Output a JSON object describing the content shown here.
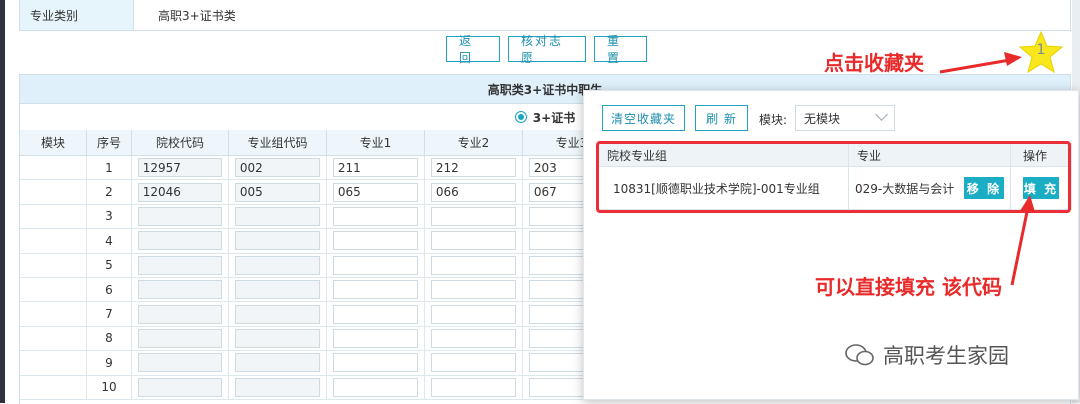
{
  "category": {
    "label": "专业类别",
    "value": "高职3+证书类"
  },
  "actions": {
    "back": "返 回",
    "verify": "核对志愿",
    "reset": "重 置"
  },
  "table": {
    "title": "高职类3+证书中职生",
    "radio_label": "3+证书",
    "headers": [
      "模块",
      "序号",
      "院校代码",
      "专业组代码",
      "专业1",
      "专业2",
      "专业3"
    ],
    "rows": [
      {
        "no": "1",
        "school": "12957",
        "group": "002",
        "m1": "211",
        "m2": "212",
        "m3": "203"
      },
      {
        "no": "2",
        "school": "12046",
        "group": "005",
        "m1": "065",
        "m2": "066",
        "m3": "067"
      },
      {
        "no": "3",
        "school": "",
        "group": "",
        "m1": "",
        "m2": "",
        "m3": ""
      },
      {
        "no": "4",
        "school": "",
        "group": "",
        "m1": "",
        "m2": "",
        "m3": ""
      },
      {
        "no": "5",
        "school": "",
        "group": "",
        "m1": "",
        "m2": "",
        "m3": ""
      },
      {
        "no": "6",
        "school": "",
        "group": "",
        "m1": "",
        "m2": "",
        "m3": ""
      },
      {
        "no": "7",
        "school": "",
        "group": "",
        "m1": "",
        "m2": "",
        "m3": ""
      },
      {
        "no": "8",
        "school": "",
        "group": "",
        "m1": "",
        "m2": "",
        "m3": ""
      },
      {
        "no": "9",
        "school": "",
        "group": "",
        "m1": "",
        "m2": "",
        "m3": ""
      },
      {
        "no": "10",
        "school": "",
        "group": "",
        "m1": "",
        "m2": "",
        "m3": ""
      }
    ]
  },
  "favorites": {
    "clear_button": "清空收藏夹",
    "refresh_button": "刷 新",
    "module_label": "模块:",
    "module_value": "无模块",
    "headers": {
      "group": "院校专业组",
      "major": "专业",
      "action": "操作"
    },
    "items": [
      {
        "group": "10831[顺德职业技术学院]-001专业组",
        "major": "029-大数据与会计",
        "remove": "移 除",
        "fill": "填 充"
      }
    ]
  },
  "annotations": {
    "favorites_hint": "点击收藏夹",
    "fill_hint": "可以直接填充 该代码",
    "star_count": "1"
  },
  "watermark": "高职考生家园",
  "colors": {
    "accent": "#1aadc4",
    "annotation": "#e82a2a",
    "star": "#f8e71c"
  }
}
